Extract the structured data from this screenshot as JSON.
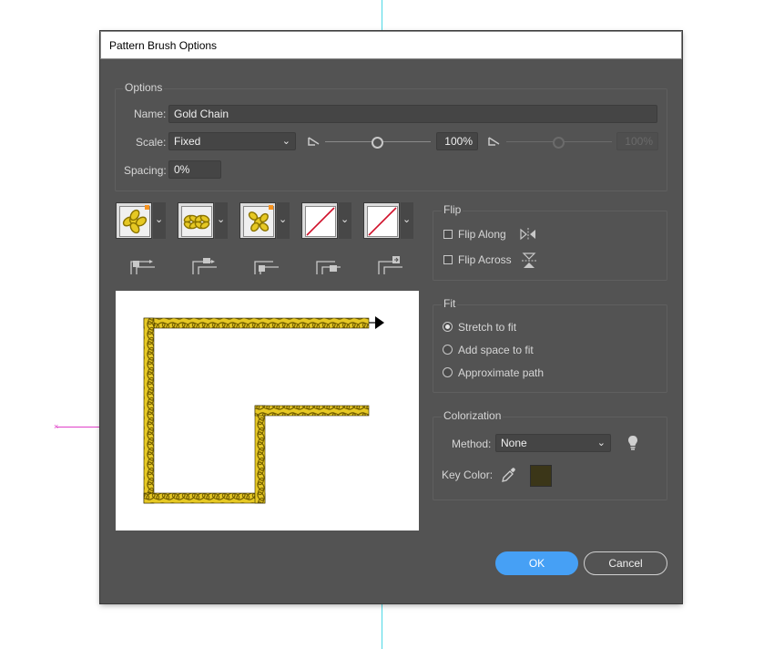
{
  "dialog": {
    "title": "Pattern Brush Options",
    "options": {
      "group_title": "Options",
      "name_label": "Name:",
      "name_value": "Gold Chain",
      "scale_label": "Scale:",
      "scale_value": "Fixed",
      "scale_min_percent": "100%",
      "scale_max_percent": "100%",
      "spacing_label": "Spacing:",
      "spacing_value": "0%"
    },
    "tiles": [
      {
        "name": "side-tile",
        "has_pattern": true,
        "marked": true
      },
      {
        "name": "outer-corner-tile",
        "has_pattern": true,
        "marked": false
      },
      {
        "name": "inner-corner-tile",
        "has_pattern": true,
        "marked": true
      },
      {
        "name": "start-tile",
        "has_pattern": false,
        "marked": false
      },
      {
        "name": "end-tile",
        "has_pattern": false,
        "marked": false
      }
    ],
    "flip": {
      "group_title": "Flip",
      "flip_along_label": "Flip Along",
      "flip_along_checked": false,
      "flip_across_label": "Flip Across",
      "flip_across_checked": false
    },
    "fit": {
      "group_title": "Fit",
      "options": [
        "Stretch to fit",
        "Add space to fit",
        "Approximate path"
      ],
      "selected": "Stretch to fit"
    },
    "colorization": {
      "group_title": "Colorization",
      "method_label": "Method:",
      "method_value": "None",
      "key_color_label": "Key Color:",
      "key_color": "#3b3618"
    },
    "buttons": {
      "ok": "OK",
      "cancel": "Cancel"
    }
  },
  "colors": {
    "dialog_bg": "#535353",
    "accent": "#46a0f5",
    "chain_gold": "#e6c823",
    "guide_cyan": "#4dd8e6",
    "guide_magenta": "#e040c8"
  }
}
